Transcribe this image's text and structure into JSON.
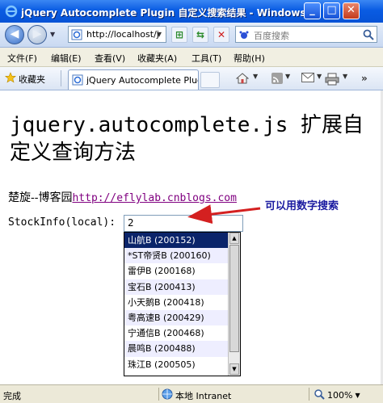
{
  "window": {
    "title": "jQuery Autocomplete Plugin 自定义搜索结果 - Windows I...",
    "minimize": "_",
    "maximize": "□",
    "close": "✕"
  },
  "nav": {
    "back_glyph": "◀",
    "forward_glyph": "▶",
    "address": "http://localhost/j",
    "search_placeholder": "百度搜索"
  },
  "menu": {
    "items": [
      "文件(F)",
      "编辑(E)",
      "查看(V)",
      "收藏夹(A)",
      "工具(T)",
      "帮助(H)"
    ]
  },
  "tabs": {
    "favorites_label": "收藏夹",
    "active_tab": "jQuery Autocomplete Plugin ..."
  },
  "page": {
    "title": "jquery.autocomplete.js 扩展自定义查询方法",
    "author_prefix": "楚旋--博客园",
    "author_link": "http://eflylab.cnblogs.com",
    "stock_label": "StockInfo(local):",
    "stock_value": "2",
    "annotation": "可以用数字搜索"
  },
  "autocomplete": {
    "items": [
      "山航B (200152)",
      "*ST帝贤B (200160)",
      "雷伊B (200168)",
      "宝石B (200413)",
      "小天鹅B (200418)",
      "粤高速B (200429)",
      "宁通信B (200468)",
      "晨鸣B (200488)",
      "珠江B (200505)"
    ],
    "selected_index": 0
  },
  "status": {
    "left": "完成",
    "zone": "本地 Intranet",
    "zoom": "100%"
  },
  "colors": {
    "titlebar": "#0a5ce3",
    "selection": "#0a246a",
    "link_visited": "#800080",
    "annotation": "#1a1aa0",
    "arrow": "#d42020",
    "alt_row": "#eeeeff"
  }
}
